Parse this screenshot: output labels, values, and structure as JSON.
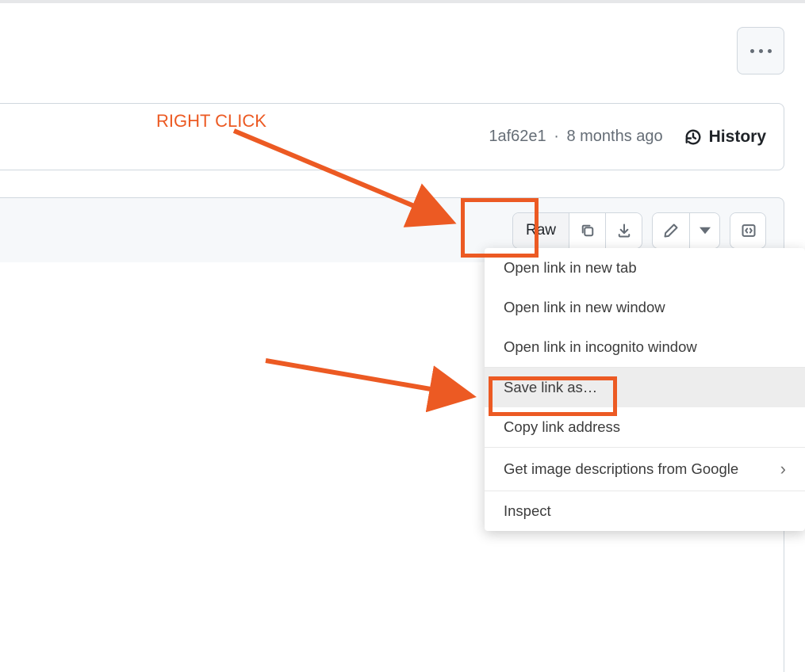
{
  "commit": {
    "sha": "1af62e1",
    "age": "8 months ago",
    "history_label": "History"
  },
  "toolbar": {
    "raw_label": "Raw"
  },
  "context_menu": {
    "items": [
      "Open link in new tab",
      "Open link in new window",
      "Open link in incognito window"
    ],
    "save_as": "Save link as…",
    "copy_addr": "Copy link address",
    "get_image_desc": "Get image descriptions from Google",
    "inspect": "Inspect"
  },
  "annotation": {
    "label": "RIGHT CLICK"
  }
}
